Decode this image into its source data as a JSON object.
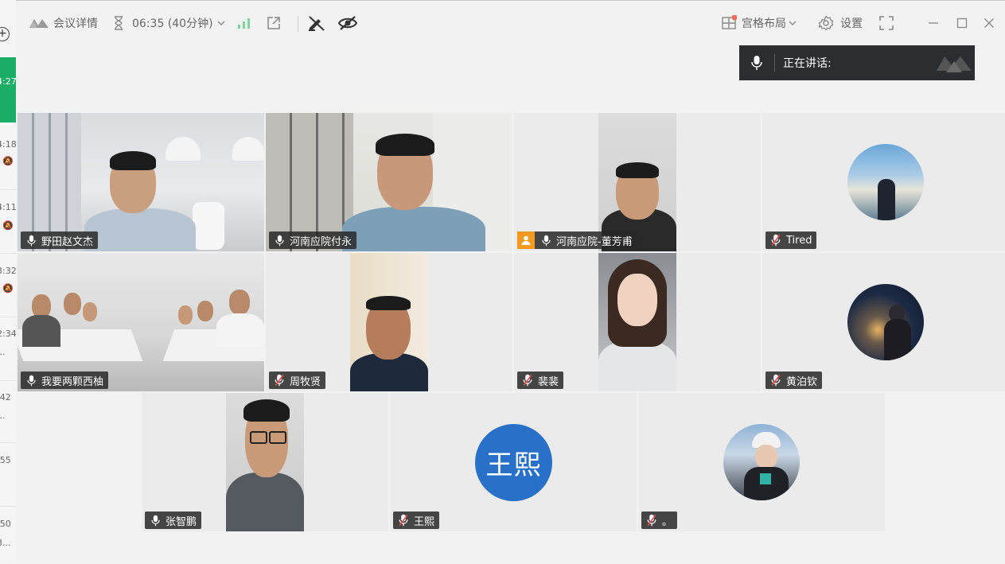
{
  "sidebar_fragments": {
    "times": [
      "4:27",
      "4:18",
      "4:11",
      "3:32",
      "2:34",
      ":42",
      ":55",
      ":50"
    ],
    "more": [
      "...",
      "..."
    ],
    "trailing": "3..."
  },
  "toolbar": {
    "meeting_details": "会议详情",
    "timer": "06:35 (40分钟)",
    "layout": "宫格布局",
    "settings": "设置",
    "icons": [
      "app-logo-icon",
      "hourglass-icon",
      "chevron-down-icon",
      "signal-icon",
      "share-out-icon",
      "pen-off-icon",
      "eye-off-icon",
      "grid-layout-icon",
      "gear-icon",
      "fullscreen-icon",
      "minimize-icon",
      "maximize-icon",
      "close-icon"
    ]
  },
  "speaking": {
    "label": "正在讲话:"
  },
  "participants": [
    {
      "name": "野田赵文杰",
      "mic": "on"
    },
    {
      "name": "河南应院付永",
      "mic": "on"
    },
    {
      "name": "河南应院-董芳甫",
      "mic": "on",
      "host": true
    },
    {
      "name": "Tired",
      "mic": "off"
    },
    {
      "name": "我要两颗西柚",
      "mic": "on"
    },
    {
      "name": "周牧贤",
      "mic": "off"
    },
    {
      "name": "裴裴",
      "mic": "off"
    },
    {
      "name": "黄泊钦",
      "mic": "off"
    },
    {
      "name": "张智鹏",
      "mic": "on"
    },
    {
      "name": "王熙",
      "mic": "off",
      "initials": "王熙"
    },
    {
      "name": "。",
      "mic": "off"
    }
  ],
  "colors": {
    "accent_green": "#1aad65",
    "host_orange": "#f29a1f",
    "avatar_blue": "#2870c8",
    "speaking_bg": "#2b2d30"
  }
}
